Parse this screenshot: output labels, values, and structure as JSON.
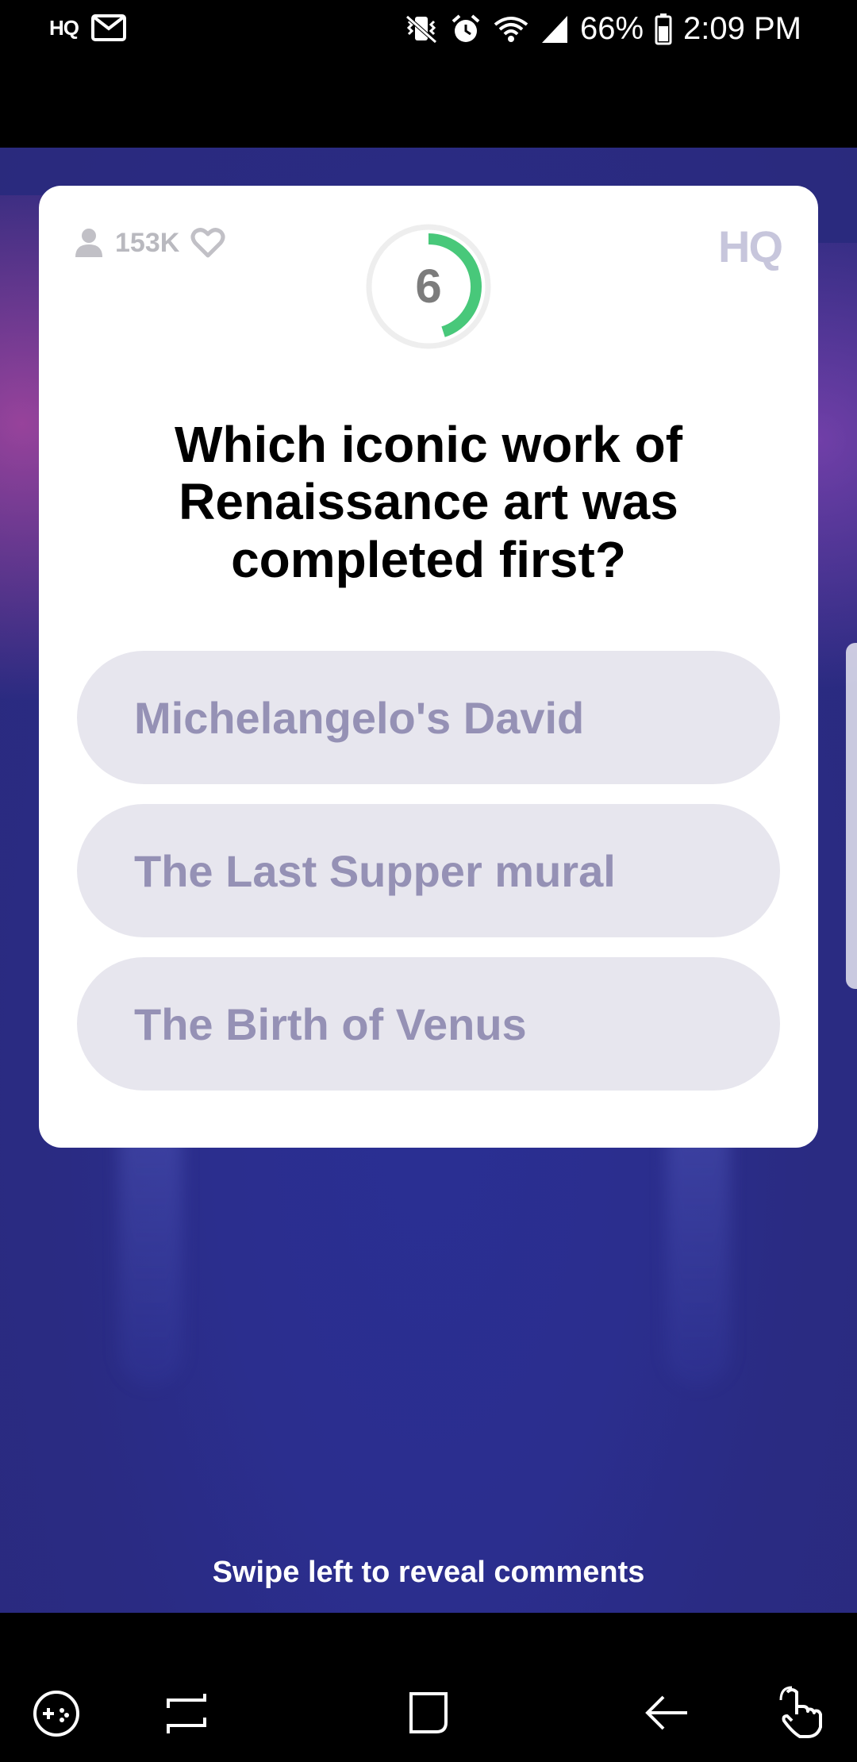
{
  "status_bar": {
    "app_icon": "HQ",
    "battery": "66%",
    "time": "2:09 PM",
    "icons": [
      "hq-app-icon",
      "mail-icon",
      "vibrate-icon",
      "alarm-icon",
      "wifi-icon",
      "signal-icon",
      "battery-icon"
    ]
  },
  "card": {
    "viewers": "153K",
    "logo": "HQ",
    "timer": "6",
    "timer_progress": 0.45,
    "question": "Which iconic work of Renaissance art was completed first?",
    "answers": [
      {
        "label": "Michelangelo's David"
      },
      {
        "label": "The Last Supper mural"
      },
      {
        "label": "The Birth of Venus"
      }
    ]
  },
  "hint": "Swipe left to reveal comments",
  "nav_bar": {
    "buttons": [
      "game-launcher-icon",
      "recent-apps-icon",
      "home-icon",
      "back-icon",
      "one-hand-icon"
    ]
  },
  "colors": {
    "timer_ring": "#48c87a",
    "answer_bg": "#e7e6ee",
    "answer_text": "#9591b5",
    "background": "#2a2c85"
  }
}
